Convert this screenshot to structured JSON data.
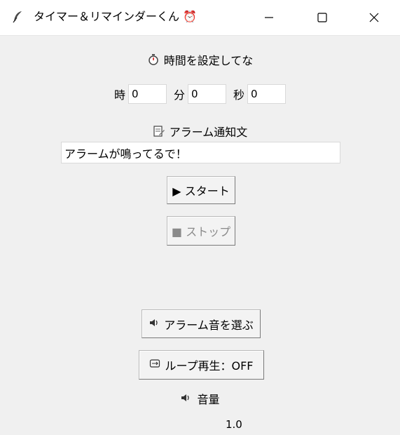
{
  "window": {
    "title": "タイマー＆リマインダーくん ⏰"
  },
  "timer": {
    "heading": "時間を設定してな",
    "hours_label": "時",
    "hours_value": "0",
    "minutes_label": "分",
    "minutes_value": "0",
    "seconds_label": "秒",
    "seconds_value": "0"
  },
  "alarm": {
    "message_heading": "アラーム通知文",
    "message_value": "アラームが鳴ってるで！"
  },
  "buttons": {
    "start": "▶ スタート",
    "stop": "■ ストップ",
    "choose_sound": "アラーム音を選ぶ",
    "loop": "ループ再生：OFF"
  },
  "volume": {
    "label": "音量",
    "value": "1.0"
  },
  "colors": {
    "background": "#f0f0f0",
    "titlebar": "#ffffff",
    "disabled_text": "#8a8a8a"
  },
  "icons": [
    "feather-icon",
    "stopwatch-icon",
    "memo-icon",
    "speaker-icon",
    "loop-icon"
  ]
}
